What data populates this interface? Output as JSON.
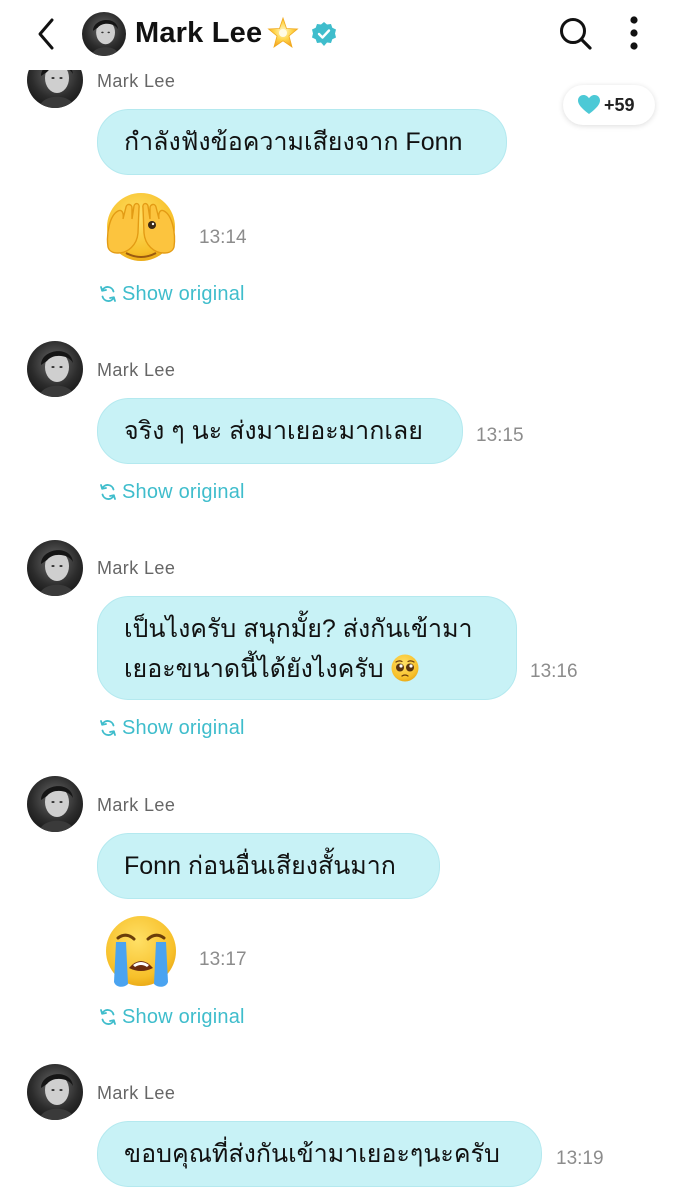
{
  "header": {
    "title": "Mark Lee",
    "icons": {
      "back": "chevron-left-icon",
      "star": "sparkle-star-icon",
      "verified": "verified-badge-icon",
      "search": "search-icon",
      "more": "more-vertical-icon"
    }
  },
  "like_pill": {
    "icon": "heart-icon",
    "count": "+59"
  },
  "colors": {
    "bubble": "#c8f2f6",
    "accent": "#3fbdcc",
    "verified": "#3fbdcc",
    "heart": "#4cc9d6"
  },
  "messages": [
    {
      "sender": "Mark Lee",
      "text": "กำลังฟังข้อความเสียงจาก Fonn",
      "emoji": "face-covering-eyes-emoji",
      "time": "13:14",
      "show_original": "Show original"
    },
    {
      "sender": "Mark Lee",
      "text": "จริง ๆ นะ ส่งมาเยอะมากเลย",
      "time": "13:15",
      "show_original": "Show original"
    },
    {
      "sender": "Mark Lee",
      "line1": "เป็นไงครับ สนุกมั้ย? ส่งกันเข้ามา",
      "line2": "เยอะขนาดนี้ได้ยังไงครับ",
      "inline_emoji": "pleading-face-emoji",
      "time": "13:16",
      "show_original": "Show original"
    },
    {
      "sender": "Mark Lee",
      "text": "Fonn ก่อนอื่นเสียงสั้นมาก",
      "emoji": "loudly-crying-face-emoji",
      "time": "13:17",
      "show_original": "Show original"
    },
    {
      "sender": "Mark Lee",
      "text": "ขอบคุณที่ส่งกันเข้ามาเยอะๆนะครับ",
      "time": "13:19"
    }
  ]
}
